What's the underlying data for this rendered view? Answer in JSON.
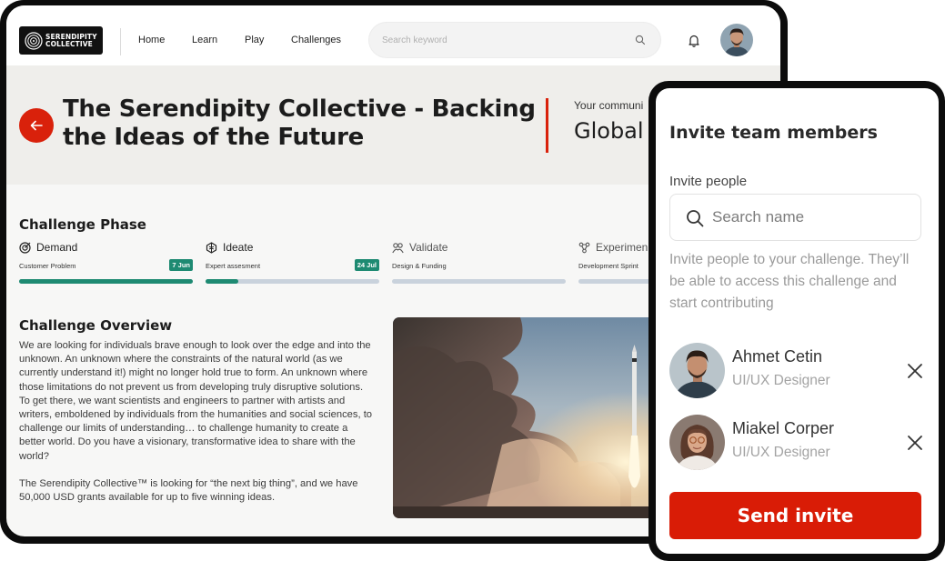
{
  "brand": {
    "logo_line1": "SERENDIPITY",
    "logo_line2": "COLLECTIVE"
  },
  "nav": {
    "items": [
      "Home",
      "Learn",
      "Play",
      "Challenges"
    ]
  },
  "search": {
    "placeholder": "Search keyword"
  },
  "hero": {
    "title": "The Serendipity Collective - Backing the Ideas of the Future",
    "community_label": "Your communi",
    "community_value": "Global"
  },
  "phase_section": {
    "title": "Challenge Phase",
    "phases": [
      {
        "name": "Demand",
        "sub": "Customer Problem",
        "date": "7 Jun",
        "progress": 1.0,
        "icon": "target-icon"
      },
      {
        "name": "Ideate",
        "sub": "Expert assesment",
        "date": "24 Jul",
        "progress": 0.19,
        "icon": "brain-icon"
      },
      {
        "name": "Validate",
        "sub": "Design & Funding",
        "date": "",
        "progress": 0,
        "icon": "people-icon"
      },
      {
        "name": "Experimen",
        "sub": "Development Sprint",
        "date": "",
        "progress": 0,
        "icon": "nodes-icon"
      }
    ]
  },
  "overview": {
    "title": "Challenge Overview",
    "paragraph1": "We are looking for individuals brave enough to look over the edge and into the unknown. An unknown where the constraints of the natural world (as we currently understand it!) might no longer hold true to form. An unknown where those limitations do not prevent us from developing truly disruptive solutions. To get there, we want scientists and engineers to partner with artists and writers, emboldened by individuals from the humanities and social sciences, to challenge our limits of understanding… to challenge humanity to create a better world. Do you have a visionary, transformative idea to share with the world?",
    "paragraph2": "The Serendipity Collective™ is looking for “the next big thing”, and we have 50,000 USD grants available for up to five winning ideas."
  },
  "invite": {
    "title": "Invite team members",
    "label": "Invite people",
    "search_placeholder": "Search name",
    "description": "Invite people to your challenge. They’ll be able to access this challenge and start contributing",
    "people": [
      {
        "name": "Ahmet Cetin",
        "role": "UI/UX Designer"
      },
      {
        "name": "Miakel Corper",
        "role": "UI/UX Designer"
      }
    ],
    "send_label": "Send invite"
  },
  "colors": {
    "accent_red": "#d9210b",
    "progress_green": "#1e8a72",
    "hero_bg": "#efeeeb"
  }
}
